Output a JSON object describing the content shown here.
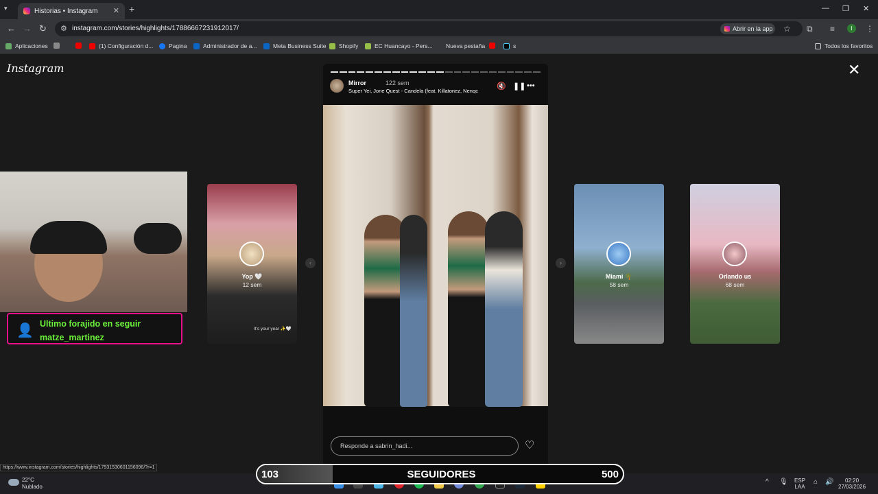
{
  "browser": {
    "tab_title": "Historias • Instagram",
    "url": "instagram.com/stories/highlights/17886667231912017/",
    "open_in_app": "Abrir en la app",
    "profile_initial": "I"
  },
  "bookmarks": {
    "items": [
      {
        "label": "Aplicaciones",
        "icon": "apps-icon"
      },
      {
        "label": "(1) Configuración d...",
        "icon": "youtube-icon"
      },
      {
        "label": "Pagina",
        "icon": "facebook-icon"
      },
      {
        "label": "Administrador de a...",
        "icon": "meta-icon"
      },
      {
        "label": "Meta Business Suite",
        "icon": "meta-icon"
      },
      {
        "label": "Shopify",
        "icon": "shopify-icon"
      },
      {
        "label": "EC Huancayo - Pers...",
        "icon": "shopify-icon"
      },
      {
        "label": "Nueva pestaña",
        "icon": "none"
      },
      {
        "label": "s",
        "icon": "tiktok-icon"
      }
    ],
    "all_favorites": "Todos los favoritos"
  },
  "instagram": {
    "logo": "Instagram",
    "story": {
      "username": "Mirror",
      "time": "122 sem",
      "music": "Super Yei, Jone Quest - Candela (feat. Killatonez, Nenqc",
      "reply_placeholder": "Responde a sabrin_hadi...",
      "progress_total": 24,
      "progress_done": 13
    },
    "side_stories": [
      {
        "name": "Yop 🤍",
        "time": "12 sem",
        "caption": "It's your year ✨🤍"
      },
      {
        "name": "Miami 🌴",
        "time": "58 sem",
        "caption": ""
      },
      {
        "name": "Orlando us",
        "time": "68 sem",
        "caption": ""
      }
    ]
  },
  "overlay": {
    "alert_line1": "Ultimo forajido en seguir",
    "alert_line2": "matze_martinez",
    "follow_current": "103",
    "follow_label": "SEGUIDORES",
    "follow_goal": "500",
    "follow_progress": 0.206
  },
  "status_url": "https://www.instagram.com/stories/highlights/17931530601156096/?r=1",
  "taskbar": {
    "temp": "22°C",
    "weather": "Nublado",
    "lang": "ESP",
    "region": "LAA",
    "time": "02:20",
    "date": "27/03/2026"
  }
}
